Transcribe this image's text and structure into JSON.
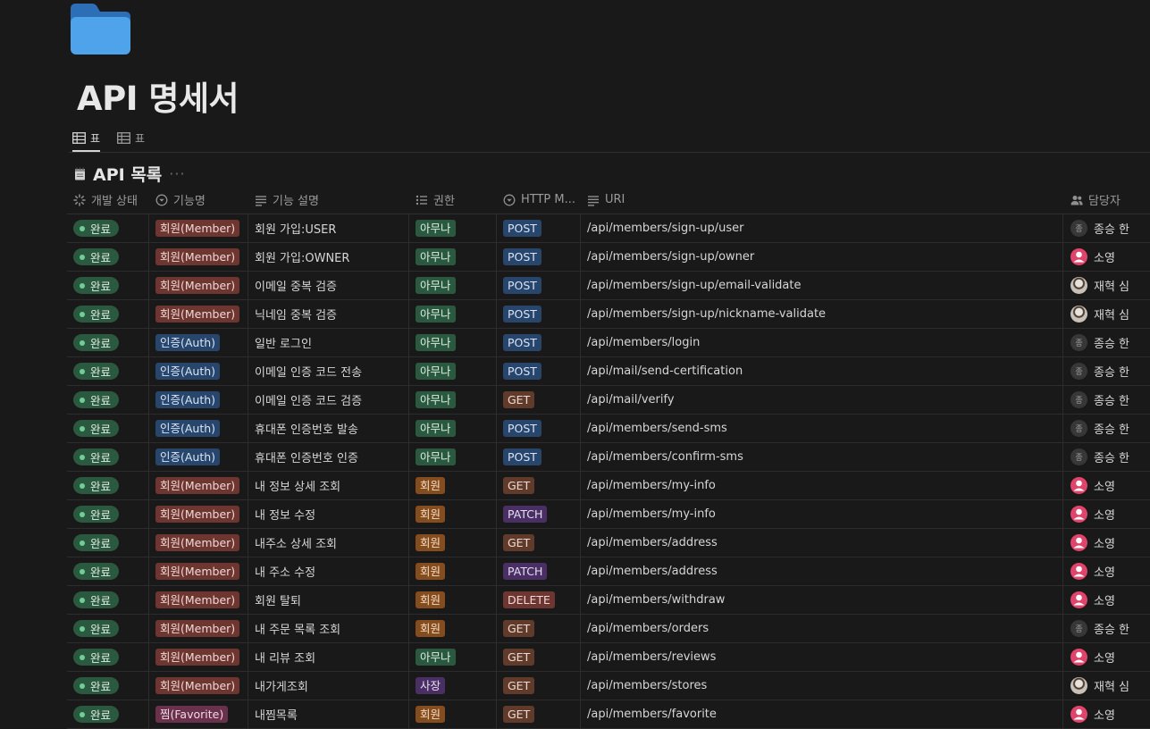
{
  "page": {
    "title": "API 명세서"
  },
  "views": [
    {
      "label": "표",
      "active": true
    },
    {
      "label": "표",
      "active": false
    }
  ],
  "database": {
    "title": "API 목록",
    "more": "···"
  },
  "columns": [
    "개발 상태",
    "기능명",
    "기능 설명",
    "권한",
    "HTTP M...",
    "URI",
    "담당자"
  ],
  "rows": [
    {
      "status": "완료",
      "category": "회원(Member)",
      "cat_type": "member",
      "description": "회원 가입:USER",
      "permission": "아무나",
      "perm_type": "any",
      "method": "POST",
      "uri": "/api/members/sign-up/user",
      "owner": "종승 한",
      "avatar": "gray",
      "avatar_text": "종"
    },
    {
      "status": "완료",
      "category": "회원(Member)",
      "cat_type": "member",
      "description": "회원 가입:OWNER",
      "permission": "아무나",
      "perm_type": "any",
      "method": "POST",
      "uri": "/api/members/sign-up/owner",
      "owner": "소영",
      "avatar": "pink",
      "avatar_text": ""
    },
    {
      "status": "완료",
      "category": "회원(Member)",
      "cat_type": "member",
      "description": "이메일 중복 검증",
      "permission": "아무나",
      "perm_type": "any",
      "method": "POST",
      "uri": "/api/members/sign-up/email-validate",
      "owner": "재혁 심",
      "avatar": "photo",
      "avatar_text": ""
    },
    {
      "status": "완료",
      "category": "회원(Member)",
      "cat_type": "member",
      "description": "닉네임 중복 검증",
      "permission": "아무나",
      "perm_type": "any",
      "method": "POST",
      "uri": "/api/members/sign-up/nickname-validate",
      "owner": "재혁 심",
      "avatar": "photo",
      "avatar_text": ""
    },
    {
      "status": "완료",
      "category": "인증(Auth)",
      "cat_type": "auth",
      "description": "일반 로그인",
      "permission": "아무나",
      "perm_type": "any",
      "method": "POST",
      "uri": "/api/members/login",
      "owner": "종승 한",
      "avatar": "gray",
      "avatar_text": "종"
    },
    {
      "status": "완료",
      "category": "인증(Auth)",
      "cat_type": "auth",
      "description": "이메일 인증 코드 전송",
      "permission": "아무나",
      "perm_type": "any",
      "method": "POST",
      "uri": "/api/mail/send-certification",
      "owner": "종승 한",
      "avatar": "gray",
      "avatar_text": "종"
    },
    {
      "status": "완료",
      "category": "인증(Auth)",
      "cat_type": "auth",
      "description": "이메일 인증 코드 검증",
      "permission": "아무나",
      "perm_type": "any",
      "method": "GET",
      "uri": "/api/mail/verify",
      "owner": "종승 한",
      "avatar": "gray",
      "avatar_text": "종"
    },
    {
      "status": "완료",
      "category": "인증(Auth)",
      "cat_type": "auth",
      "description": "휴대폰 인증번호 발송",
      "permission": "아무나",
      "perm_type": "any",
      "method": "POST",
      "uri": "/api/members/send-sms",
      "owner": "종승 한",
      "avatar": "gray",
      "avatar_text": "종"
    },
    {
      "status": "완료",
      "category": "인증(Auth)",
      "cat_type": "auth",
      "description": "휴대폰 인증번호 인증",
      "permission": "아무나",
      "perm_type": "any",
      "method": "POST",
      "uri": "/api/members/confirm-sms",
      "owner": "종승 한",
      "avatar": "gray",
      "avatar_text": "종"
    },
    {
      "status": "완료",
      "category": "회원(Member)",
      "cat_type": "member",
      "description": "내 정보 상세 조회",
      "permission": "회원",
      "perm_type": "member",
      "method": "GET",
      "uri": "/api/members/my-info",
      "owner": "소영",
      "avatar": "pink",
      "avatar_text": ""
    },
    {
      "status": "완료",
      "category": "회원(Member)",
      "cat_type": "member",
      "description": "내 정보 수정",
      "permission": "회원",
      "perm_type": "member",
      "method": "PATCH",
      "uri": "/api/members/my-info",
      "owner": "소영",
      "avatar": "pink",
      "avatar_text": ""
    },
    {
      "status": "완료",
      "category": "회원(Member)",
      "cat_type": "member",
      "description": "내주소 상세 조회",
      "permission": "회원",
      "perm_type": "member",
      "method": "GET",
      "uri": "/api/members/address",
      "owner": "소영",
      "avatar": "pink",
      "avatar_text": ""
    },
    {
      "status": "완료",
      "category": "회원(Member)",
      "cat_type": "member",
      "description": "내 주소 수정",
      "permission": "회원",
      "perm_type": "member",
      "method": "PATCH",
      "uri": "/api/members/address",
      "owner": "소영",
      "avatar": "pink",
      "avatar_text": ""
    },
    {
      "status": "완료",
      "category": "회원(Member)",
      "cat_type": "member",
      "description": "회원 탈퇴",
      "permission": "회원",
      "perm_type": "member",
      "method": "DELETE",
      "uri": "/api/members/withdraw",
      "owner": "소영",
      "avatar": "pink",
      "avatar_text": ""
    },
    {
      "status": "완료",
      "category": "회원(Member)",
      "cat_type": "member",
      "description": "내 주문 목록 조회",
      "permission": "회원",
      "perm_type": "member",
      "method": "GET",
      "uri": "/api/members/orders",
      "owner": "종승 한",
      "avatar": "gray",
      "avatar_text": "종"
    },
    {
      "status": "완료",
      "category": "회원(Member)",
      "cat_type": "member",
      "description": "내 리뷰 조회",
      "permission": "아무나",
      "perm_type": "any",
      "method": "GET",
      "uri": "/api/members/reviews",
      "owner": "소영",
      "avatar": "pink",
      "avatar_text": ""
    },
    {
      "status": "완료",
      "category": "회원(Member)",
      "cat_type": "member",
      "description": "내가게조회",
      "permission": "사장",
      "perm_type": "owner",
      "method": "GET",
      "uri": "/api/members/stores",
      "owner": "재혁 심",
      "avatar": "photo",
      "avatar_text": ""
    },
    {
      "status": "완료",
      "category": "찜(Favorite)",
      "cat_type": "fav",
      "description": "내찜목록",
      "permission": "회원",
      "perm_type": "member",
      "method": "GET",
      "uri": "/api/members/favorite",
      "owner": "소영",
      "avatar": "pink",
      "avatar_text": ""
    }
  ]
}
